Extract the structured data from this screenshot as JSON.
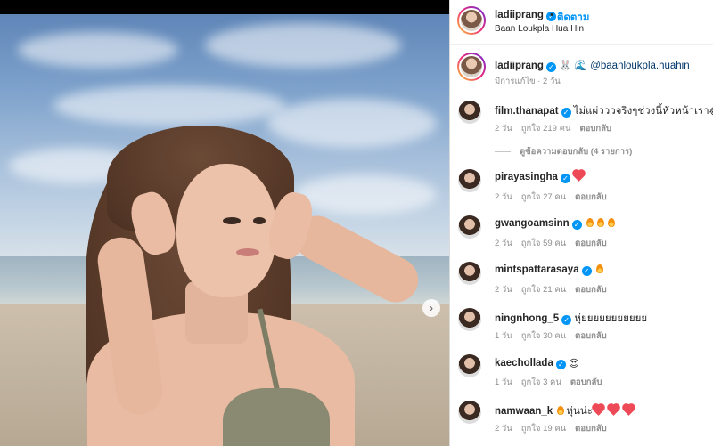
{
  "post": {
    "username": "ladiiprang",
    "follow_label": "ติดตาม",
    "separator": "•",
    "location": "Baan Loukpla Hua Hin",
    "next_icon": "chevron-right-icon",
    "caption_mention": "@baanloukpla.huahin",
    "caption_emojis": "🐰 🌊",
    "caption_meta": "มีการแก้ไข · 2 วัน"
  },
  "comments": [
    {
      "username": "film.thanapat",
      "verified": true,
      "text": "ไม่แผ่วววจริงๆช่วงนี้หัวหน้าเรา",
      "emoji": "😂",
      "time": "2 วัน",
      "likes": "ถูกใจ 219 คน",
      "reply": "ตอบกลับ",
      "view_replies": "ดูข้อความตอบกลับ (4 รายการ)"
    },
    {
      "username": "pirayasingha",
      "verified": true,
      "text": "",
      "emoji": "heart",
      "time": "2 วัน",
      "likes": "ถูกใจ 27 คน",
      "reply": "ตอบกลับ"
    },
    {
      "username": "gwangoamsinn",
      "verified": true,
      "text": "",
      "emoji": "fire3",
      "time": "2 วัน",
      "likes": "ถูกใจ 59 คน",
      "reply": "ตอบกลับ"
    },
    {
      "username": "mintspattarasaya",
      "verified": true,
      "text": "",
      "emoji": "fire1",
      "time": "2 วัน",
      "likes": "ถูกใจ 21 คน",
      "reply": "ตอบกลับ"
    },
    {
      "username": "ningnhong_5",
      "verified": true,
      "text": "หุ่ยยยยยยยยยยย",
      "emoji": "",
      "time": "1 วัน",
      "likes": "ถูกใจ 30 คน",
      "reply": "ตอบกลับ"
    },
    {
      "username": "kaechollada",
      "verified": true,
      "text": "",
      "emoji": "😍",
      "time": "1 วัน",
      "likes": "ถูกใจ 3 คน",
      "reply": "ตอบกลับ"
    },
    {
      "username": "namwaan_k",
      "verified": false,
      "text": "หุ่นน่ะ",
      "emoji": "fire-hearts",
      "time": "2 วัน",
      "likes": "ถูกใจ 19 คน",
      "reply": "ตอบกลับ"
    }
  ],
  "colors": {
    "accent": "#0095f6",
    "muted": "#8e8e8e",
    "text": "#262626"
  }
}
